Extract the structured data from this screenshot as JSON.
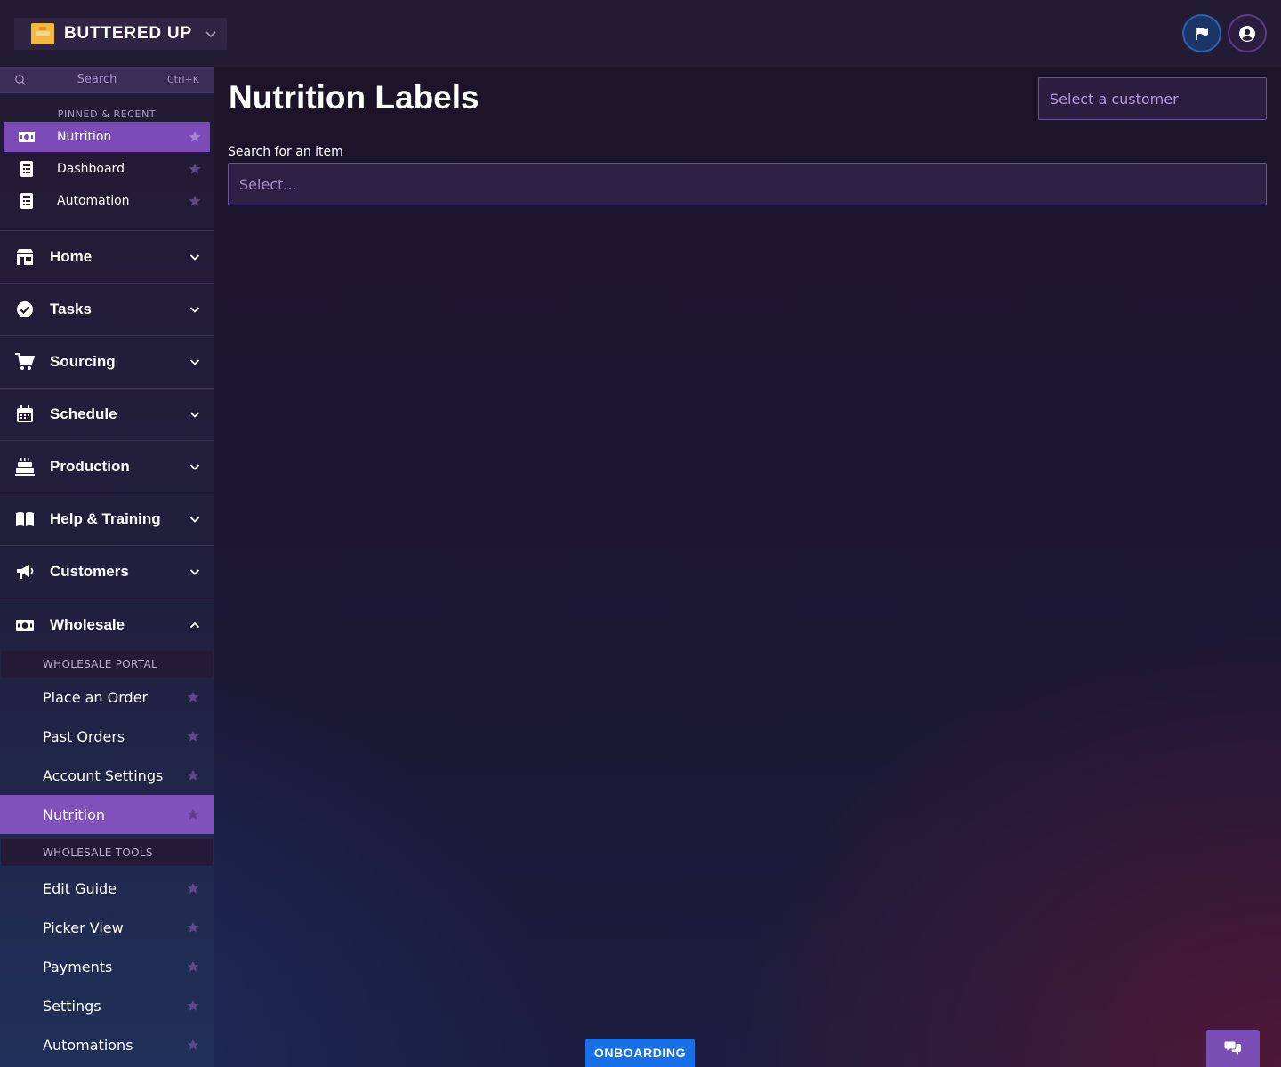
{
  "header": {
    "brand_name": "BUTTERED UP"
  },
  "search": {
    "label": "Search",
    "shortcut": "Ctrl+K"
  },
  "pinned": {
    "caption": "PINNED & RECENT",
    "items": [
      {
        "label": "Nutrition",
        "icon": "money-icon"
      },
      {
        "label": "Dashboard",
        "icon": "calculator-icon"
      },
      {
        "label": "Automation",
        "icon": "calculator-icon"
      }
    ]
  },
  "nav": {
    "groups": [
      {
        "label": "Home",
        "icon": "store-icon"
      },
      {
        "label": "Tasks",
        "icon": "check-badge-icon"
      },
      {
        "label": "Sourcing",
        "icon": "cart-icon"
      },
      {
        "label": "Schedule",
        "icon": "calendar-icon"
      },
      {
        "label": "Production",
        "icon": "cake-icon"
      },
      {
        "label": "Help & Training",
        "icon": "book-icon"
      },
      {
        "label": "Customers",
        "icon": "megaphone-icon"
      },
      {
        "label": "Wholesale",
        "icon": "money-icon"
      }
    ],
    "wholesale": {
      "portal_caption": "WHOLESALE PORTAL",
      "portal_items": [
        "Place an Order",
        "Past Orders",
        "Account Settings",
        "Nutrition"
      ],
      "tools_caption": "WHOLESALE TOOLS",
      "tools_items": [
        "Edit Guide",
        "Picker View",
        "Payments",
        "Settings",
        "Automations"
      ]
    }
  },
  "main": {
    "title": "Nutrition Labels",
    "customer_select_placeholder": "Select a customer",
    "item_search_label": "Search for an item",
    "item_select_placeholder": "Select..."
  },
  "footer": {
    "onboarding_label": "ONBOARDING"
  },
  "colors": {
    "accent": "#7b4bb7",
    "onboarding": "#1770e6",
    "star": "#5e4a86"
  }
}
